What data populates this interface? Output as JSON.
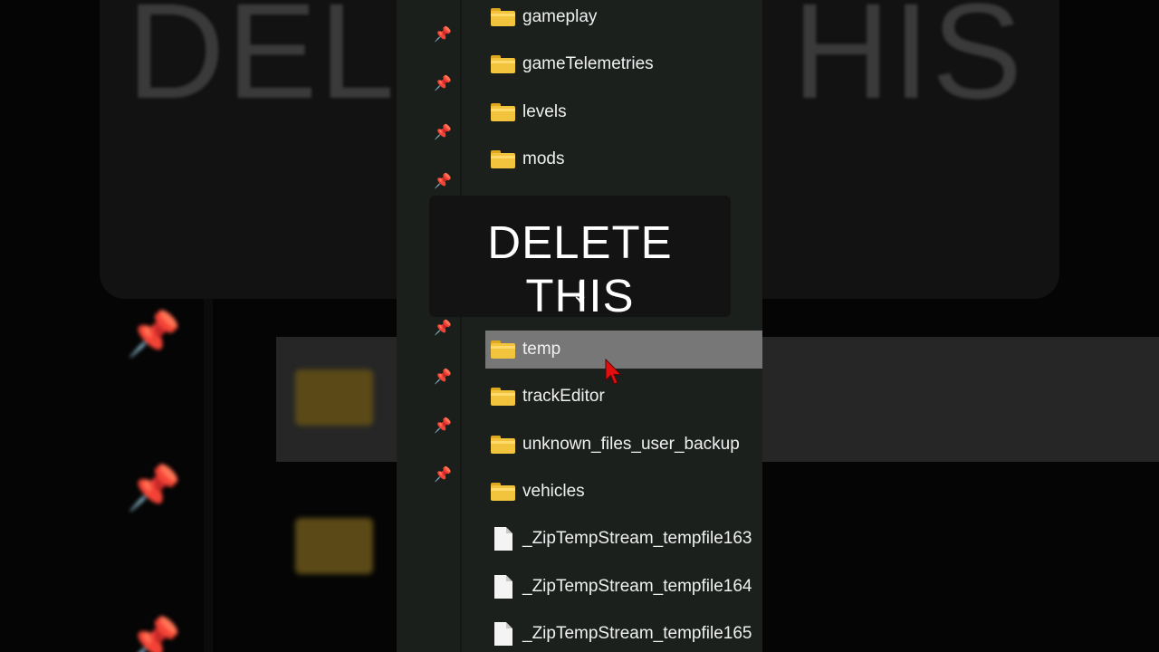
{
  "overlay": {
    "caption": "DELETE THIS",
    "arrow": "↓"
  },
  "background": {
    "caption_fragment_left": "DEL",
    "caption_fragment_right": "HIS"
  },
  "explorer": {
    "items": [
      {
        "label": "gameplay",
        "type": "folder",
        "selected": false
      },
      {
        "label": "gameTelemetries",
        "type": "folder",
        "selected": false
      },
      {
        "label": "levels",
        "type": "folder",
        "selected": false
      },
      {
        "label": "mods",
        "type": "folder",
        "selected": false
      },
      {
        "label": "temp",
        "type": "folder",
        "selected": true
      },
      {
        "label": "trackEditor",
        "type": "folder",
        "selected": false
      },
      {
        "label": "unknown_files_user_backup",
        "type": "folder",
        "selected": false
      },
      {
        "label": "vehicles",
        "type": "folder",
        "selected": false
      },
      {
        "label": "_ZipTempStream_tempfile163",
        "type": "file",
        "selected": false
      },
      {
        "label": "_ZipTempStream_tempfile164",
        "type": "file",
        "selected": false
      },
      {
        "label": "_ZipTempStream_tempfile165",
        "type": "file",
        "selected": false
      }
    ],
    "pin_icon": "pin-icon"
  },
  "colors": {
    "folder": "#f2c33c",
    "selection": "#777777",
    "cursor": "#e01010"
  }
}
